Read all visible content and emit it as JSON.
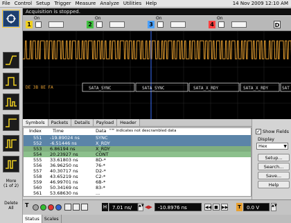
{
  "menu": [
    "File",
    "Control",
    "Setup",
    "Trigger",
    "Measure",
    "Analyze",
    "Utilities",
    "Help"
  ],
  "datetime": "14 Nov 2009 12:10 AM",
  "status": "Acquisition is stopped.",
  "channels": [
    {
      "num": "1",
      "state": "On",
      "color": "#f0d020"
    },
    {
      "num": "2",
      "state": "On",
      "color": "#40c040"
    },
    {
      "num": "3",
      "state": "On",
      "color": "#4aa0ff"
    },
    {
      "num": "4",
      "state": "On",
      "color": "#ff4040"
    }
  ],
  "channel_d": "D",
  "decode_bytes": "DE  3B  8E  FA",
  "decode_labels": [
    "SATA_SYNC",
    "SATA_SYNC",
    "SATA_X_RDY",
    "SATA_X_RDY",
    "SAT"
  ],
  "symbol_tabs": [
    "Symbols",
    "Packets",
    "Details",
    "Payload",
    "Header"
  ],
  "table_headers": {
    "index": "Index",
    "time": "Time",
    "data": "Data",
    "note": "\"\"\" indicates not descrambled data"
  },
  "rows": [
    {
      "index": "551",
      "time": "-19.89024 ns",
      "data": "SYNC"
    },
    {
      "index": "552",
      "time": "-6.51446 ns",
      "data": "X_RDY"
    },
    {
      "index": "553",
      "time": "6.86194 ns",
      "data": "X_RDY"
    },
    {
      "index": "554",
      "time": "20.23927 ns",
      "data": "CONT"
    },
    {
      "index": "555",
      "time": "33.61803 ns",
      "data": "8D-*"
    },
    {
      "index": "556",
      "time": "36.96250 ns",
      "data": "76-*"
    },
    {
      "index": "557",
      "time": "40.30717 ns",
      "data": "D2-*"
    },
    {
      "index": "558",
      "time": "43.65219 ns",
      "data": "C2-*"
    },
    {
      "index": "559",
      "time": "46.99701 ns",
      "data": "6B-*"
    },
    {
      "index": "560",
      "time": "50.34169 ns",
      "data": "83-*"
    },
    {
      "index": "561",
      "time": "53.68630 ns",
      "data": "..."
    }
  ],
  "right_panel": {
    "show_fields": "Show Fields",
    "display_format_label": "Display Format",
    "display_format_value": "Hex",
    "buttons": [
      "Setup...",
      "Search...",
      "Save...",
      "Help"
    ]
  },
  "left_panel": {
    "more": "More",
    "more_sub": "(1 of 2)",
    "delete": "Delete",
    "delete_sub": "All"
  },
  "bottom": {
    "t_label": "T",
    "h_label": "H",
    "timebase": "7.01 ns/",
    "position": "-10.8976 ns",
    "trig_level_label": "T",
    "trig_level": "0.0 V"
  },
  "bottom_tabs": [
    "Status",
    "Scales"
  ],
  "colors": {
    "trace": "#e8a030",
    "cursor": "#3a6fff"
  }
}
